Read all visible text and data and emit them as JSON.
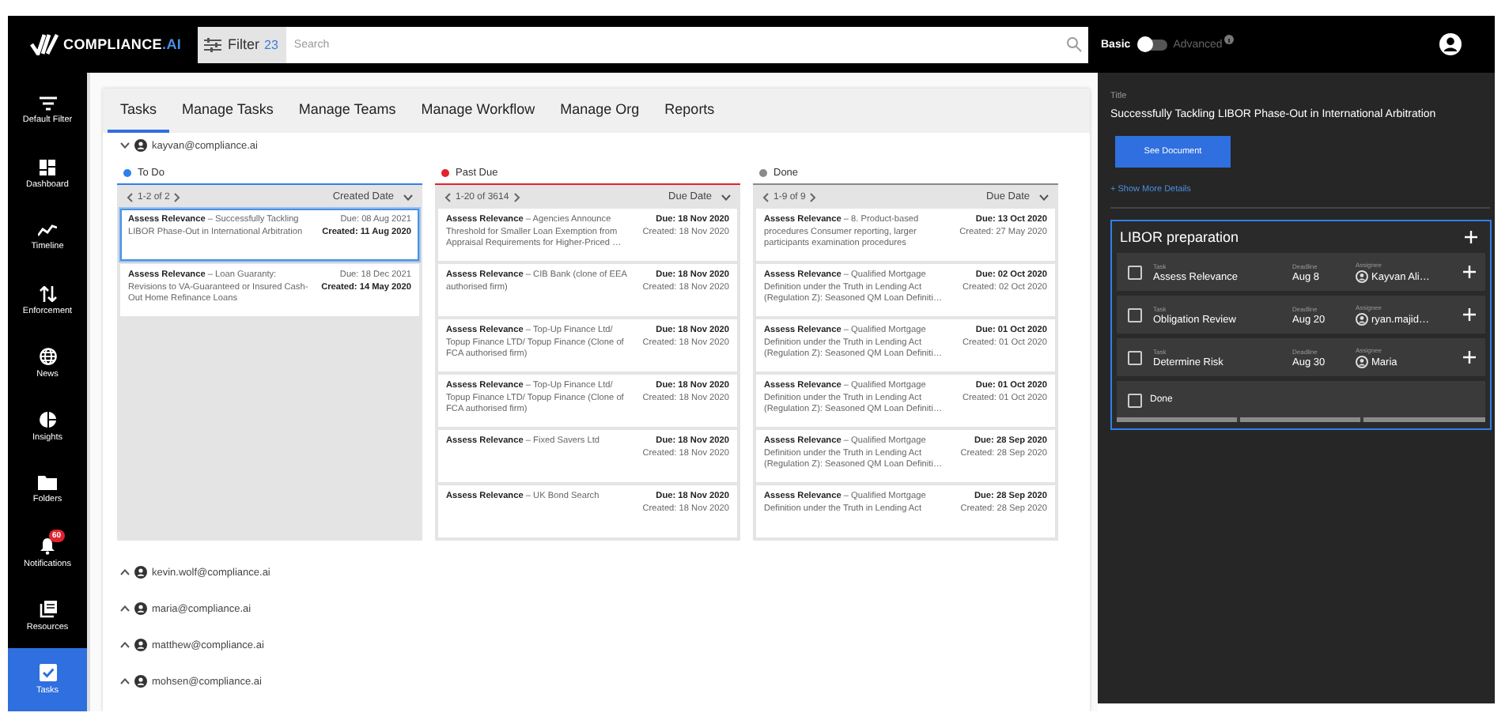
{
  "app": {
    "logo": "COMPLIANCE",
    "logo_accent": ".AI"
  },
  "search": {
    "filter_label": "Filter",
    "filter_count": "23",
    "placeholder": "Search"
  },
  "mode": {
    "basic": "Basic",
    "advanced": "Advanced",
    "advanced_on": false
  },
  "sidebar": [
    {
      "label": "Default Filter",
      "kind": "filter",
      "selected": false
    },
    {
      "label": "Dashboard",
      "kind": "dashboard",
      "selected": false
    },
    {
      "label": "Timeline",
      "kind": "timeline",
      "selected": false
    },
    {
      "label": "Enforcement",
      "kind": "enforcement",
      "selected": false
    },
    {
      "label": "News",
      "kind": "news",
      "selected": false
    },
    {
      "label": "Insights",
      "kind": "insights",
      "selected": false
    },
    {
      "label": "Folders",
      "kind": "folders",
      "selected": false
    },
    {
      "label": "Notifications",
      "kind": "notifications",
      "selected": false,
      "badge": "60"
    },
    {
      "label": "Resources",
      "kind": "resources",
      "selected": false
    },
    {
      "label": "Tasks",
      "kind": "tasks",
      "selected": true
    }
  ],
  "tabs": [
    {
      "label": "Tasks",
      "selected": true
    },
    {
      "label": "Manage Tasks",
      "selected": false
    },
    {
      "label": "Manage Teams",
      "selected": false
    },
    {
      "label": "Manage Workflow",
      "selected": false
    },
    {
      "label": "Manage Org",
      "selected": false
    },
    {
      "label": "Reports",
      "selected": false
    }
  ],
  "users": [
    {
      "email": "kayvan@compliance.ai",
      "expanded": true,
      "columns": [
        {
          "title": "To Do",
          "color": "#2f80ed",
          "pager": "1-2 of 2",
          "sort": "Created Date",
          "cards": [
            {
              "text": "**Assess Relevance** – Successfully Tackling LIBOR Phase-Out in International Arbitration",
              "due": "Due: 08 Aug 2021",
              "created": "Created: 11 Aug 2020",
              "due_bold": false,
              "created_bold": true,
              "selected": true
            },
            {
              "text": "**Assess Relevance** – Loan Guaranty: Revisions to VA-Guaranteed or Insured Cash-Out Home Refinance Loans",
              "due": "Due: 18 Dec 2021",
              "created": "Created: 14 May 2020",
              "due_bold": false,
              "created_bold": true,
              "selected": false
            }
          ]
        },
        {
          "title": "Past Due",
          "color": "#e0232e",
          "pager": "1-20 of 3614",
          "sort": "Due Date",
          "cards": [
            {
              "text": "**Assess Relevance** – Agencies Announce Threshold for Smaller Loan Exemption from Appraisal Requirements for Higher-Priced …",
              "due": "Due: 18 Nov 2020",
              "created": "Created: 18 Nov 2020",
              "due_bold": true,
              "created_bold": false,
              "selected": false
            },
            {
              "text": "**Assess Relevance** – CIB Bank (clone of EEA authorised firm)",
              "due": "Due: 18 Nov 2020",
              "created": "Created: 18 Nov 2020",
              "due_bold": true,
              "created_bold": false,
              "selected": false
            },
            {
              "text": "**Assess Relevance** – Top-Up Finance Ltd/ Topup Finance LTD/ Topup Finance (Clone of FCA authorised firm)",
              "due": "Due: 18 Nov 2020",
              "created": "Created: 18 Nov 2020",
              "due_bold": true,
              "created_bold": false,
              "selected": false
            },
            {
              "text": "**Assess Relevance** – Top-Up Finance Ltd/ Topup Finance LTD/ Topup Finance (Clone of FCA authorised firm)",
              "due": "Due: 18 Nov 2020",
              "created": "Created: 18 Nov 2020",
              "due_bold": true,
              "created_bold": false,
              "selected": false
            },
            {
              "text": "**Assess Relevance** – Fixed Savers Ltd",
              "due": "Due: 18 Nov 2020",
              "created": "Created: 18 Nov 2020",
              "due_bold": true,
              "created_bold": false,
              "selected": false
            },
            {
              "text": "**Assess Relevance** – UK Bond Search",
              "due": "Due: 18 Nov 2020",
              "created": "Created: 18 Nov 2020",
              "due_bold": true,
              "created_bold": false,
              "selected": false
            }
          ]
        },
        {
          "title": "Done",
          "color": "#8a8a8a",
          "pager": "1-9 of 9",
          "sort": "Due Date",
          "cards": [
            {
              "text": "**Assess Relevance** – 8. Product-based procedures Consumer reporting, larger participants examination procedures",
              "due": "Due: 13 Oct 2020",
              "created": "Created: 27 May 2020",
              "due_bold": true,
              "created_bold": false,
              "selected": false
            },
            {
              "text": "**Assess Relevance** – Qualified Mortgage Definition under the Truth in Lending Act (Regulation Z): Seasoned QM Loan Definiti…",
              "due": "Due: 02 Oct 2020",
              "created": "Created: 02 Oct 2020",
              "due_bold": true,
              "created_bold": false,
              "selected": false
            },
            {
              "text": "**Assess Relevance** – Qualified Mortgage Definition under the Truth in Lending Act (Regulation Z): Seasoned QM Loan Definiti…",
              "due": "Due: 01 Oct 2020",
              "created": "Created: 01 Oct 2020",
              "due_bold": true,
              "created_bold": false,
              "selected": false
            },
            {
              "text": "**Assess Relevance** – Qualified Mortgage Definition under the Truth in Lending Act (Regulation Z): Seasoned QM Loan Definiti…",
              "due": "Due: 01 Oct 2020",
              "created": "Created: 01 Oct 2020",
              "due_bold": true,
              "created_bold": false,
              "selected": false
            },
            {
              "text": "**Assess Relevance** – Qualified Mortgage Definition under the Truth in Lending Act (Regulation Z): Seasoned QM Loan Definiti…",
              "due": "Due: 28 Sep 2020",
              "created": "Created: 28 Sep 2020",
              "due_bold": true,
              "created_bold": false,
              "selected": false
            },
            {
              "text": "**Assess Relevance** – Qualified Mortgage Definition under the Truth in Lending Act",
              "due": "Due: 28 Sep 2020",
              "created": "Created: 28 Sep 2020",
              "due_bold": true,
              "created_bold": false,
              "selected": false
            }
          ]
        }
      ]
    },
    {
      "email": "kevin.wolf@compliance.ai",
      "expanded": false
    },
    {
      "email": "maria@compliance.ai",
      "expanded": false
    },
    {
      "email": "matthew@compliance.ai",
      "expanded": false
    },
    {
      "email": "mohsen@compliance.ai",
      "expanded": false
    }
  ],
  "detail": {
    "title_label": "Title",
    "title": "Successfully Tackling LIBOR Phase-Out in International Arbitration",
    "button": "See Document",
    "more": "+ Show More Details",
    "checklist": {
      "title": "LIBOR preparation",
      "tasks": [
        {
          "task_label": "Task",
          "task": "Assess Relevance",
          "deadline_label": "Deadline",
          "deadline": "Aug 8",
          "assignee_label": "Assignee",
          "assignee": "Kayvan Ali…",
          "checked": false
        },
        {
          "task_label": "Task",
          "task": "Obligation Review",
          "deadline_label": "Deadline",
          "deadline": "Aug 20",
          "assignee_label": "Assignee",
          "assignee": "ryan.majid…",
          "checked": false
        },
        {
          "task_label": "Task",
          "task": "Determine Risk",
          "deadline_label": "Deadline",
          "deadline": "Aug 30",
          "assignee_label": "Assignee",
          "assignee": "Maria",
          "checked": false
        }
      ],
      "done": {
        "label": "Done",
        "checked": false
      }
    }
  }
}
